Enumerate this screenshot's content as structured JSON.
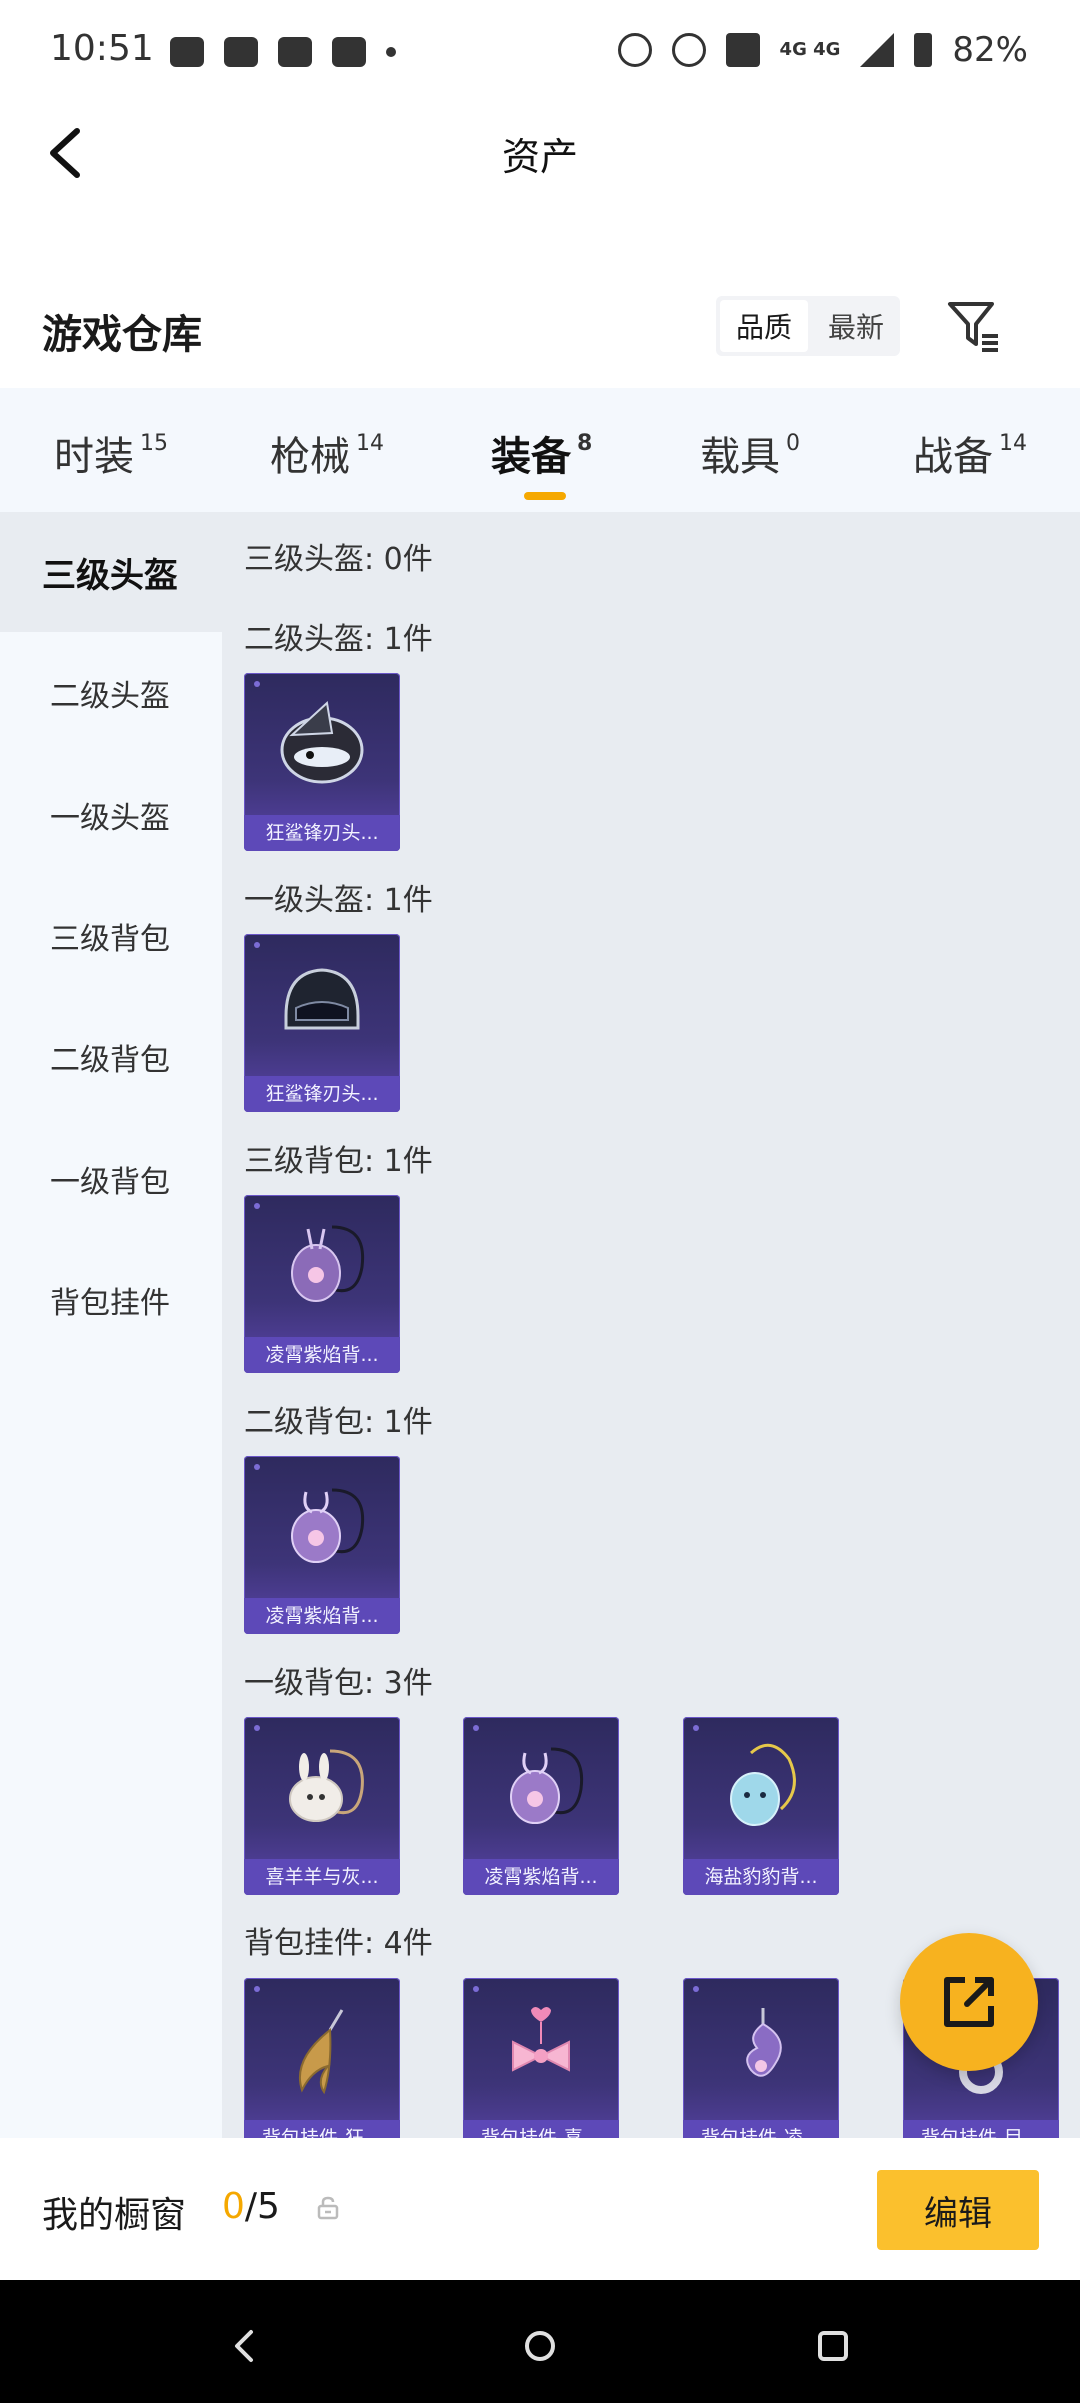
{
  "status_bar": {
    "time": "10:51",
    "network": "4G 4G",
    "battery": "82%"
  },
  "header": {
    "title": "资产"
  },
  "warehouse": {
    "title": "游戏仓库",
    "sort_options": [
      "品质",
      "最新"
    ],
    "selected_sort": "品质"
  },
  "tabs": [
    {
      "label": "时装",
      "count": "15"
    },
    {
      "label": "枪械",
      "count": "14"
    },
    {
      "label": "装备",
      "count": "8"
    },
    {
      "label": "载具",
      "count": "0"
    },
    {
      "label": "战备",
      "count": "14"
    }
  ],
  "active_tab": "装备",
  "sidebar": {
    "items": [
      "三级头盔",
      "二级头盔",
      "一级头盔",
      "三级背包",
      "二级背包",
      "一级背包",
      "背包挂件"
    ],
    "active": "三级头盔"
  },
  "sections": [
    {
      "title": "三级头盔: 0件",
      "items": []
    },
    {
      "title": "二级头盔: 1件",
      "items": [
        "狂鲨锋刃头..."
      ]
    },
    {
      "title": "一级头盔: 1件",
      "items": [
        "狂鲨锋刃头..."
      ]
    },
    {
      "title": "三级背包: 1件",
      "items": [
        "凌霄紫焰背..."
      ]
    },
    {
      "title": "二级背包: 1件",
      "items": [
        "凌霄紫焰背..."
      ]
    },
    {
      "title": "一级背包: 3件",
      "items": [
        "喜羊羊与灰...",
        "凌霄紫焰背...",
        "海盐豹豹背..."
      ]
    },
    {
      "title": "背包挂件: 4件",
      "items": [
        "背包挂件-狂...",
        "背包挂件-喜...",
        "背包挂件-凌...",
        "背包挂件-目..."
      ]
    }
  ],
  "showcase": {
    "label": "我的橱窗",
    "current": "0",
    "total": "/5",
    "edit_label": "编辑"
  },
  "colors": {
    "accent": "#f5a800",
    "card_bg": "#3d3478",
    "card_label": "#5d49b8",
    "edit_button": "#fbc02d"
  }
}
